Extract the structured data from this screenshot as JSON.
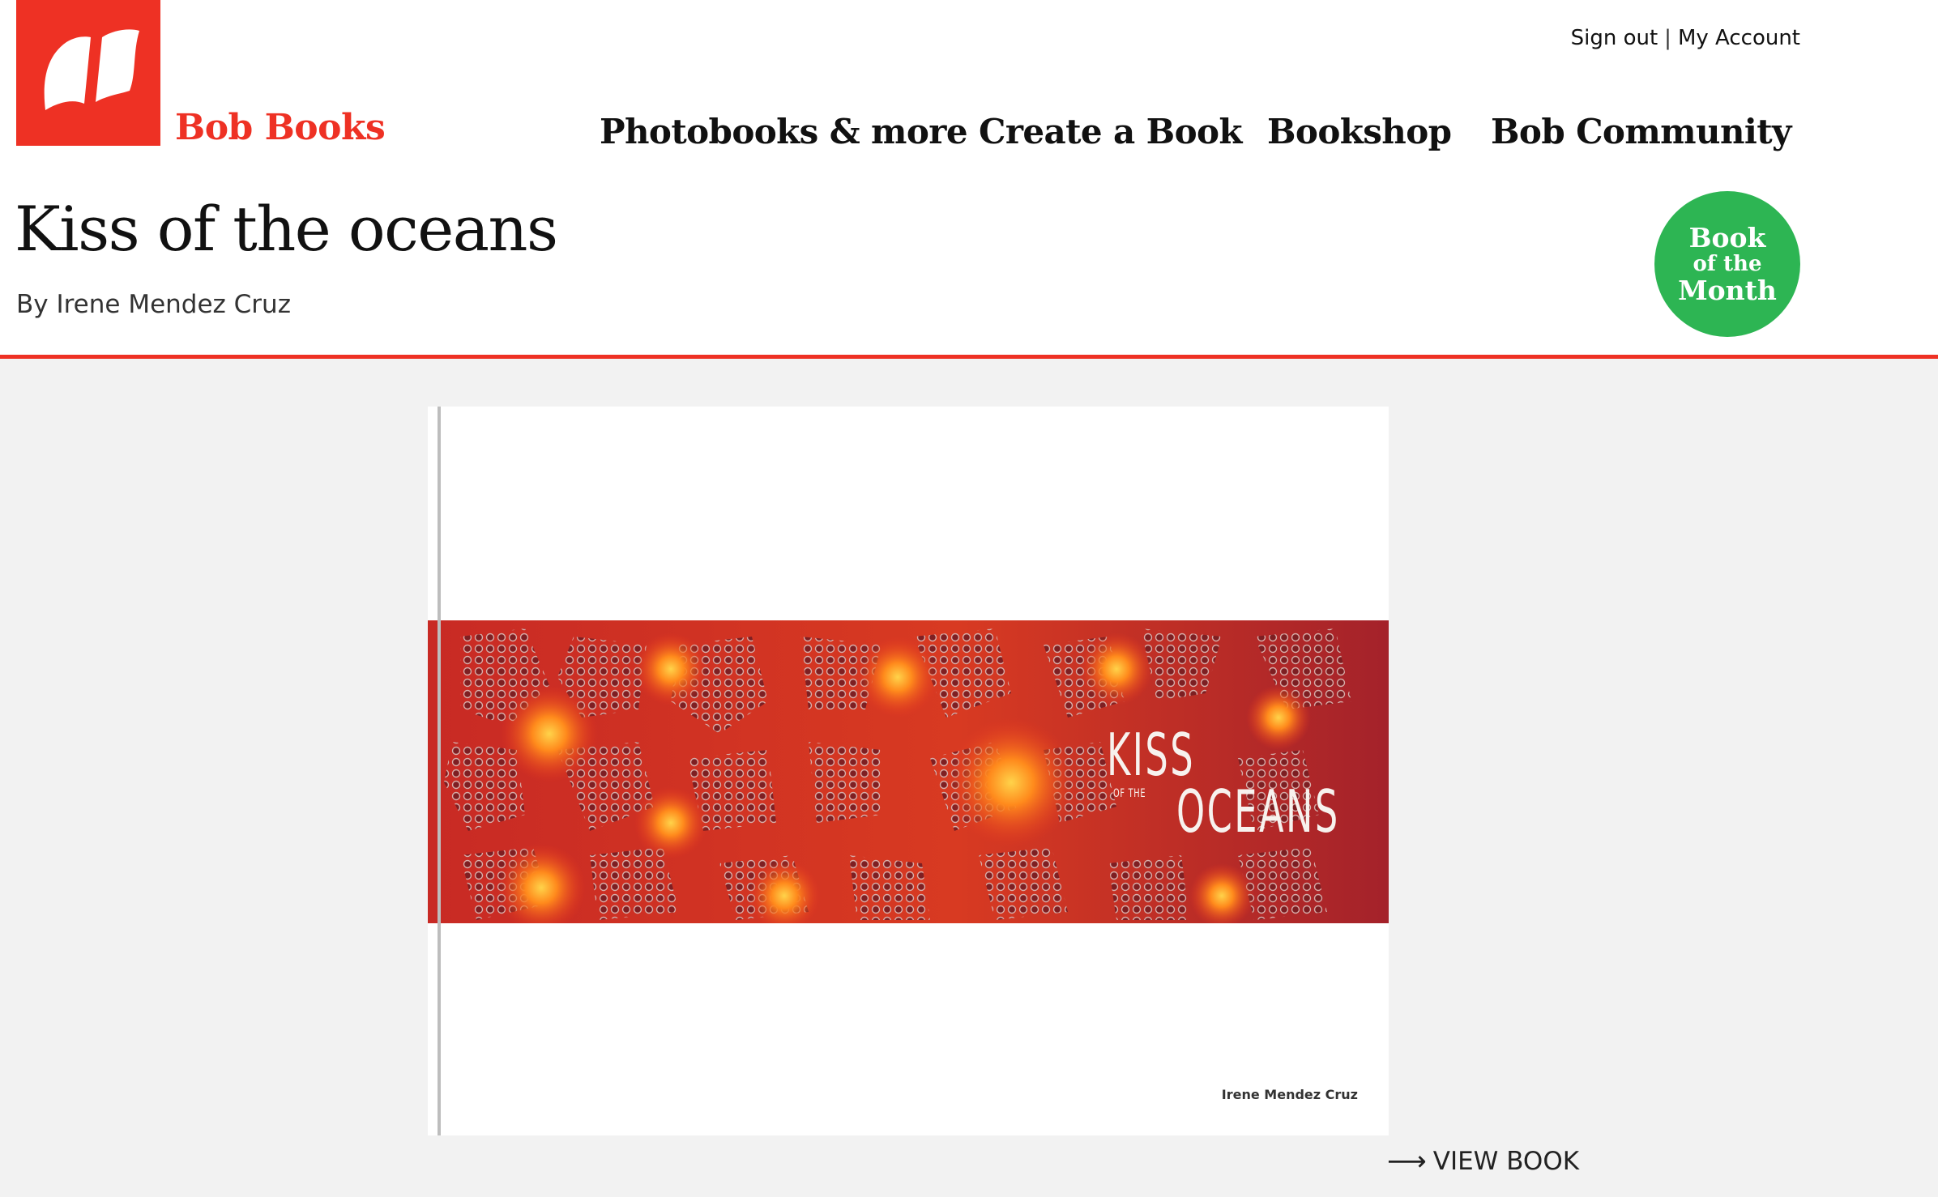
{
  "header": {
    "brand": "Bob Books",
    "account_links": {
      "sign_out": "Sign out",
      "separator": "|",
      "my_account": "My Account"
    },
    "nav": [
      "Photobooks & more",
      "Create a Book",
      "Bookshop",
      "Bob Community"
    ],
    "logo_icon": "open-book-icon"
  },
  "book": {
    "title": "Kiss of the oceans",
    "byline": "By Irene Mendez Cruz",
    "badge": {
      "line1": "Book",
      "line2": "of the",
      "line3": "Month"
    },
    "cover": {
      "title_line1": "KISS",
      "title_small": "OF THE",
      "title_line2": "OCEANS",
      "author": "Irene Mendez Cruz"
    },
    "view_label": "VIEW BOOK",
    "view_icon": "arrow-right-icon"
  },
  "colors": {
    "accent": "#ee3124",
    "badge": "#2db553",
    "background": "#f2f2f2"
  }
}
